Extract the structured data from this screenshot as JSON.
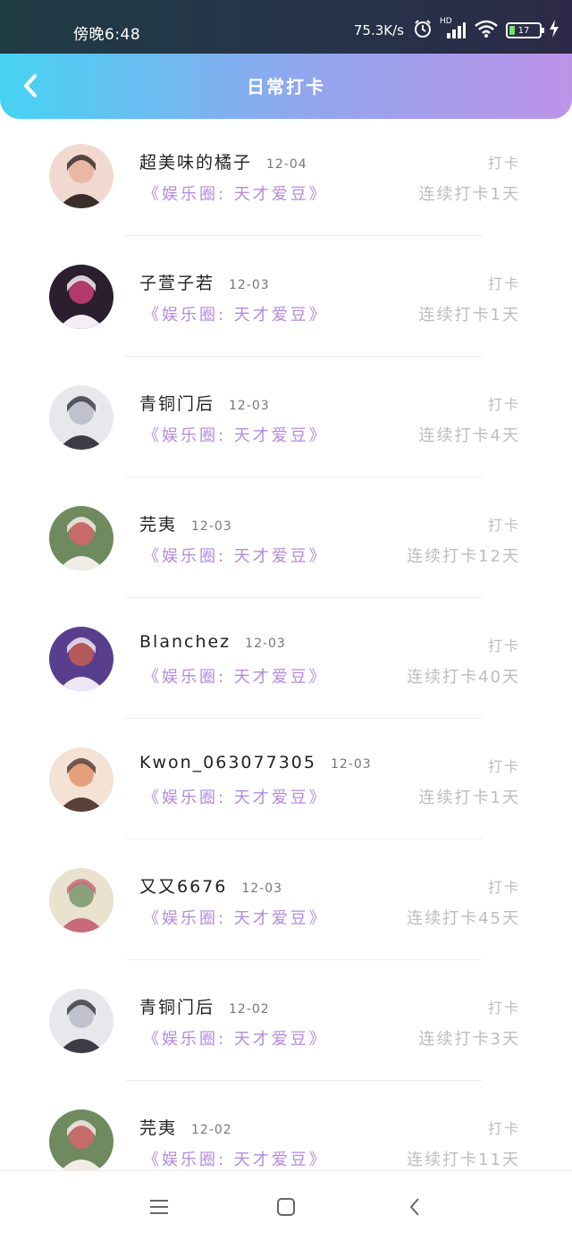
{
  "status_bar": {
    "time": "傍晚6:48",
    "network_speed": "75.3K/s",
    "signal_label": "HD",
    "battery_level": "17"
  },
  "header": {
    "title": "日常打卡"
  },
  "items": [
    {
      "name": "超美味的橘子",
      "date": "12-04",
      "circle": "《娱乐圈: 天才爱豆》",
      "action": "打卡",
      "streak": "连续打卡1天",
      "avatar": "avatar-1"
    },
    {
      "name": "子萱子若",
      "date": "12-03",
      "circle": "《娱乐圈: 天才爱豆》",
      "action": "打卡",
      "streak": "连续打卡1天",
      "avatar": "avatar-2"
    },
    {
      "name": "青铜门后",
      "date": "12-03",
      "circle": "《娱乐圈: 天才爱豆》",
      "action": "打卡",
      "streak": "连续打卡4天",
      "avatar": "avatar-3"
    },
    {
      "name": "芫夷",
      "date": "12-03",
      "circle": "《娱乐圈: 天才爱豆》",
      "action": "打卡",
      "streak": "连续打卡12天",
      "avatar": "avatar-4"
    },
    {
      "name": "Blanchez",
      "date": "12-03",
      "circle": "《娱乐圈: 天才爱豆》",
      "action": "打卡",
      "streak": "连续打卡40天",
      "avatar": "avatar-5"
    },
    {
      "name": "Kwon_063077305",
      "date": "12-03",
      "circle": "《娱乐圈: 天才爱豆》",
      "action": "打卡",
      "streak": "连续打卡1天",
      "avatar": "avatar-6"
    },
    {
      "name": "又又6676",
      "date": "12-03",
      "circle": "《娱乐圈: 天才爱豆》",
      "action": "打卡",
      "streak": "连续打卡45天",
      "avatar": "avatar-7"
    },
    {
      "name": "青铜门后",
      "date": "12-02",
      "circle": "《娱乐圈: 天才爱豆》",
      "action": "打卡",
      "streak": "连续打卡3天",
      "avatar": "avatar-3"
    },
    {
      "name": "芫夷",
      "date": "12-02",
      "circle": "《娱乐圈: 天才爱豆》",
      "action": "打卡",
      "streak": "连续打卡11天",
      "avatar": "avatar-4"
    }
  ],
  "nav_bar": {
    "icons": [
      "menu-icon",
      "home-icon",
      "back-icon"
    ]
  }
}
